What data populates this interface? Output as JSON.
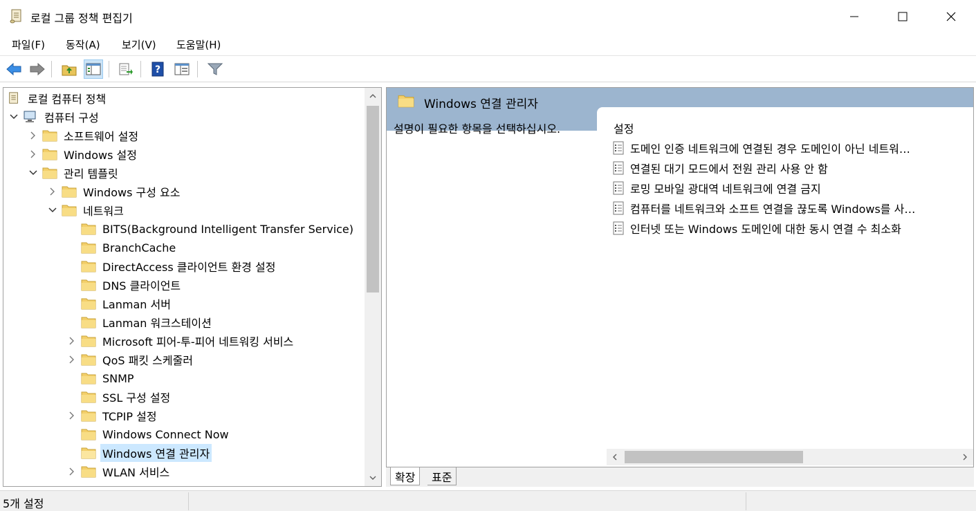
{
  "window": {
    "title": "로컬 그룹 정책 편집기",
    "app_icon": "policy-scroll-icon"
  },
  "menu": {
    "items": [
      "파일(F)",
      "동작(A)",
      "보기(V)",
      "도움말(H)"
    ]
  },
  "toolbar": {
    "buttons": [
      "back-arrow-icon",
      "forward-arrow-icon",
      "up-folder-icon",
      "show-hide-tree-icon",
      "export-list-icon",
      "help-icon",
      "properties-icon",
      "filter-icon"
    ]
  },
  "tree": {
    "root": "로컬 컴퓨터 정책",
    "computer_config": "컴퓨터 구성",
    "software_settings": "소프트웨어 설정",
    "windows_settings": "Windows 설정",
    "admin_templates": "관리 템플릿",
    "windows_components": "Windows 구성 요소",
    "network": "네트워크",
    "items": [
      "BITS(Background Intelligent Transfer Service)",
      "BranchCache",
      "DirectAccess 클라이언트 환경 설정",
      "DNS 클라이언트",
      "Lanman 서버",
      "Lanman 워크스테이션",
      "Microsoft 피어-투-피어 네트워킹 서비스",
      "QoS 패킷 스케줄러",
      "SNMP",
      "SSL 구성 설정",
      "TCPIP 설정",
      "Windows Connect Now",
      "Windows 연결 관리자",
      "WLAN 서비스"
    ],
    "selected": "Windows 연결 관리자"
  },
  "right": {
    "header_title": "Windows 연결 관리자",
    "description": "설명이 필요한 항목을 선택하십시오.",
    "settings_header": "설정",
    "settings": [
      "도메인 인증 네트워크에 연결된 경우 도메인이 아닌 네트워…",
      "연결된 대기 모드에서 전원 관리 사용 안 함",
      "로밍 모바일 광대역 네트워크에 연결 금지",
      "컴퓨터를 네트워크와 소프트 연결을 끊도록 Windows를 사…",
      "인터넷 또는 Windows 도메인에 대한 동시 연결 수 최소화"
    ]
  },
  "tabs": {
    "extended": "확장",
    "standard": "표준"
  },
  "status": {
    "text": "5개 설정"
  }
}
